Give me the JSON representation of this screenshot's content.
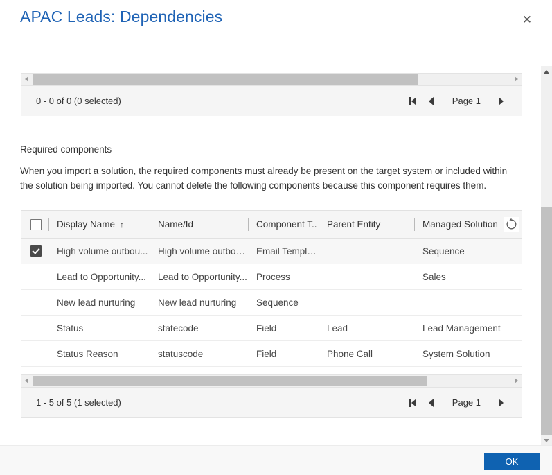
{
  "dialog": {
    "title": "APAC Leads: Dependencies",
    "close_label": "✕"
  },
  "top_grid": {
    "pager": {
      "count_text": "0 - 0 of 0 (0 selected)",
      "page_label": "Page 1",
      "first_title": "First page",
      "prev_title": "Previous page",
      "next_title": "Next page"
    }
  },
  "required_section": {
    "label": "Required components",
    "description": "When you import a solution, the required components must already be present on the target system or included within the solution being imported. You cannot delete the following components because this component requires them."
  },
  "table": {
    "columns": [
      {
        "label": "",
        "name": "select-all"
      },
      {
        "label": "Display Name",
        "name": "display-name",
        "sort": "↑"
      },
      {
        "label": "Name/Id",
        "name": "name-id",
        "sort": ""
      },
      {
        "label": "Component T..",
        "name": "component-type",
        "sort": ""
      },
      {
        "label": "Parent Entity",
        "name": "parent-entity",
        "sort": ""
      },
      {
        "label": "Managed Solution",
        "name": "managed-solution",
        "sort": ""
      }
    ],
    "rows": [
      {
        "selected": true,
        "display_name": "High volume outbou...",
        "name_id": "High volume outbou...",
        "component_type": "Email Template",
        "parent_entity": "",
        "managed_solution": "Sequence"
      },
      {
        "selected": false,
        "display_name": "Lead to Opportunity...",
        "name_id": "Lead to Opportunity...",
        "component_type": "Process",
        "parent_entity": "",
        "managed_solution": "Sales"
      },
      {
        "selected": false,
        "display_name": "New lead nurturing",
        "name_id": "New lead nurturing",
        "component_type": "Sequence",
        "parent_entity": "",
        "managed_solution": ""
      },
      {
        "selected": false,
        "display_name": "Status",
        "name_id": "statecode",
        "component_type": "Field",
        "parent_entity": "Lead",
        "managed_solution": "Lead Management"
      },
      {
        "selected": false,
        "display_name": "Status Reason",
        "name_id": "statuscode",
        "component_type": "Field",
        "parent_entity": "Phone Call",
        "managed_solution": "System Solution"
      }
    ]
  },
  "bottom_grid": {
    "pager": {
      "count_text": "1 - 5 of 5 (1 selected)",
      "page_label": "Page 1",
      "first_title": "First page",
      "prev_title": "Previous page",
      "next_title": "Next page"
    }
  },
  "footer": {
    "ok_label": "OK"
  },
  "colors": {
    "title_blue": "#1f63b5",
    "accent_button": "#0f62b1",
    "header_bg": "#f5f5f5",
    "scroll_thumb": "#c1c1c1"
  }
}
